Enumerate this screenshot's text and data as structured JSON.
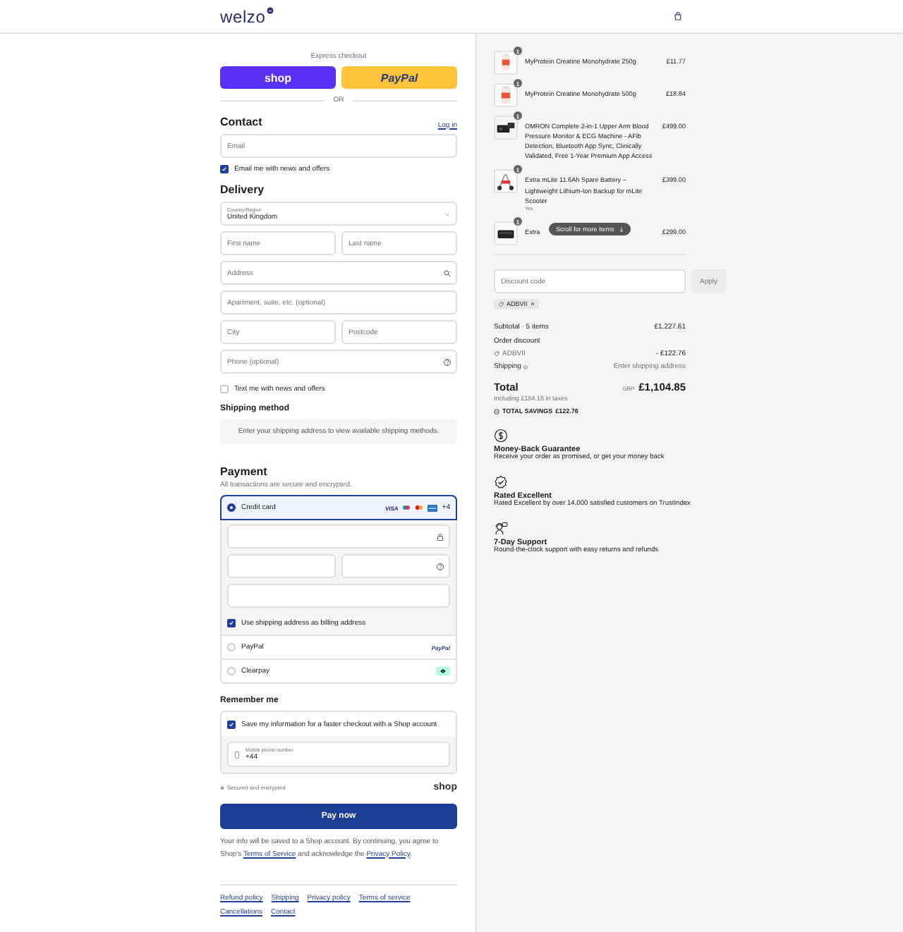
{
  "header": {
    "logo": "welzo"
  },
  "express": {
    "label": "Express checkout",
    "buttons": [
      {
        "kind": "shop",
        "label": "shop"
      },
      {
        "kind": "paypal",
        "label": "PayPal"
      }
    ],
    "divider": "OR"
  },
  "contact": {
    "title": "Contact",
    "login": "Log in",
    "email": {
      "placeholder": "Email"
    },
    "newsletter": {
      "label": "Email me with news and offers",
      "checked": true
    }
  },
  "delivery": {
    "title": "Delivery",
    "rows": [
      [
        {
          "kind": "select",
          "label": "Country/Region",
          "value": "United Kingdom"
        }
      ],
      [
        {
          "kind": "text",
          "placeholder": "First name"
        },
        {
          "kind": "text",
          "placeholder": "Last name"
        }
      ],
      [
        {
          "kind": "search",
          "placeholder": "Address"
        }
      ],
      [
        {
          "kind": "text",
          "placeholder": "Apartment, suite, etc. (optional)"
        }
      ],
      [
        {
          "kind": "text",
          "placeholder": "City"
        },
        {
          "kind": "text",
          "placeholder": "Postcode"
        }
      ],
      [
        {
          "kind": "help",
          "placeholder": "Phone (optional)"
        }
      ]
    ],
    "sms": {
      "label": "Text me with news and offers",
      "checked": false
    }
  },
  "shipping_method": {
    "title": "Shipping method",
    "notice": "Enter your shipping address to view available shipping methods."
  },
  "payment": {
    "title": "Payment",
    "subtitle": "All transactions are secure and encrypted.",
    "methods": [
      {
        "kind": "card",
        "label": "Credit card",
        "selected": true,
        "brand": "VISA",
        "more": "+4"
      },
      {
        "kind": "paypal",
        "label": "PayPal",
        "selected": false,
        "brand": "PayPal"
      },
      {
        "kind": "clearpay",
        "label": "Clearpay",
        "selected": false
      }
    ],
    "billing": {
      "label": "Use shipping address as billing address",
      "checked": true
    }
  },
  "remember": {
    "title": "Remember me",
    "save": {
      "label": "Save my information for a faster checkout with a Shop account",
      "checked": true
    },
    "phone": {
      "label": "Mobile phone number",
      "value": "+44"
    }
  },
  "secure": "Secured and encrypted",
  "shop_logo": "shop",
  "pay_button": "Pay now",
  "legal": [
    {
      "kind": "text",
      "text": "Your info will be saved to a Shop account. By continuing, you agree to Shop's "
    },
    {
      "kind": "link",
      "text": "Terms of Service"
    },
    {
      "kind": "text",
      "text": " and acknowledge the "
    },
    {
      "kind": "link",
      "text": "Privacy Policy"
    },
    {
      "kind": "text",
      "text": "."
    }
  ],
  "footer_links": [
    "Refund policy",
    "Shipping",
    "Privacy policy",
    "Terms of service",
    "Cancellations",
    "Contact"
  ],
  "order": {
    "items": [
      {
        "name": "MyProtein Creatine Monohydrate 250g",
        "price": "£11.77",
        "quantity": "1"
      },
      {
        "name": "MyProtein Creatine Monohydrate 500g",
        "price": "£18.84",
        "quantity": "1"
      },
      {
        "name": "OMRON Complete 2-in-1 Upper Arm Blood Pressure Monitor & ECG Machine - AFib Detection, Bluetooth App Sync, Clinically Validated, Free 1-Year Premium App Access",
        "price": "£499.00",
        "quantity": "1"
      },
      {
        "name": "Extra mLite 11.6Ah Spare Battery – Lightweight Lithium-Ion Backup for mLite Scooter",
        "variant": "Yes",
        "price": "£399.00",
        "quantity": "1"
      },
      {
        "name": "Extra",
        "price": "£299.00",
        "quantity": "1"
      }
    ],
    "scroll_hint": "Scroll for more items"
  },
  "discount": {
    "placeholder": "Discount code",
    "button": "Apply",
    "tags": [
      "ADBVII"
    ]
  },
  "summary": {
    "subtotal_label": "Subtotal · 5 items",
    "subtotal": "£1,227.61",
    "discount_label": "Order discount",
    "discount_code": "ADBVII",
    "discount": "- £122.76",
    "shipping_label": "Shipping",
    "shipping": "Enter shipping address",
    "total_label": "Total",
    "currency": "GBP",
    "total": "£1,104.85",
    "taxes": "Including £184.15 in taxes",
    "savings_label": "TOTAL SAVINGS",
    "savings": "£122.76"
  },
  "guarantees": [
    {
      "kind": "money",
      "title": "Money-Back Guarantee",
      "text": "Receive your order as promised, or get your money back"
    },
    {
      "kind": "rated",
      "title": "Rated Excellent",
      "text": "Rated Excellent by over 14,000 satisfied customers on TrustIndex"
    },
    {
      "kind": "support",
      "title": "7-Day Support",
      "text": "Round-the-clock support with easy returns and refunds"
    }
  ]
}
